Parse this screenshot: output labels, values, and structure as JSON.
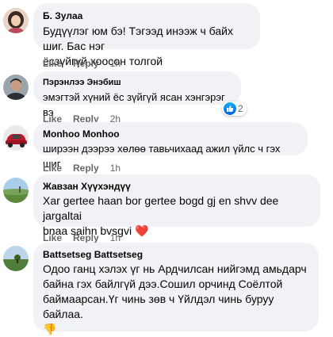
{
  "comments": [
    {
      "author": "Б. Зулаа",
      "lines": [
        "Будүүлэг юм бэ! Тэгээд инээж ч байх шиг. Бас нэг",
        "ёсзүйгүй хоосон толгой"
      ],
      "time": "1h",
      "avatar_icon": "woman-portrait-avatar"
    },
    {
      "author": "Пэрэнлээ Энэбиш",
      "lines": [
        "эмэгтэй хүний ёс зүйгүй ясан хэнгэрэг вэ"
      ],
      "time": "2h",
      "reaction_count": "2",
      "avatar_icon": "man-portrait-avatar"
    },
    {
      "author": "Monhoo Monhoo",
      "lines": [
        "ширээн дээрээ хөлөө тавьчихаад ажил үйлс ч гэх шиг"
      ],
      "time": "1h",
      "avatar_icon": "red-car-avatar"
    },
    {
      "author": "Жавзан Хүүхэндүү",
      "lines": [
        "Xar gertee haan bor gertee bogd gj en shvv dee jargaltai",
        "bnaa saihn bvsgvi ❤️"
      ],
      "time": "1h",
      "avatar_icon": "landscape-avatar"
    },
    {
      "author": "Battsetseg Battsetseg",
      "lines": [
        "Одоо ганц хэлэх үг нь Ардчилсан нийгэмд амьдарч",
        "байна гэх байлгүй дээ.Сошил орчинд Соёлтой",
        "баймаарсан.Үг чинь зөв ч Үйлдэл чинь буруу байлаа.",
        "👎"
      ],
      "avatar_icon": "landscape-avatar"
    }
  ],
  "labels": {
    "like": "Like",
    "reply": "Reply"
  },
  "colors": {
    "bubble": "#f0f2f5",
    "meta": "#65676b",
    "like_blue": "#1877f2"
  }
}
